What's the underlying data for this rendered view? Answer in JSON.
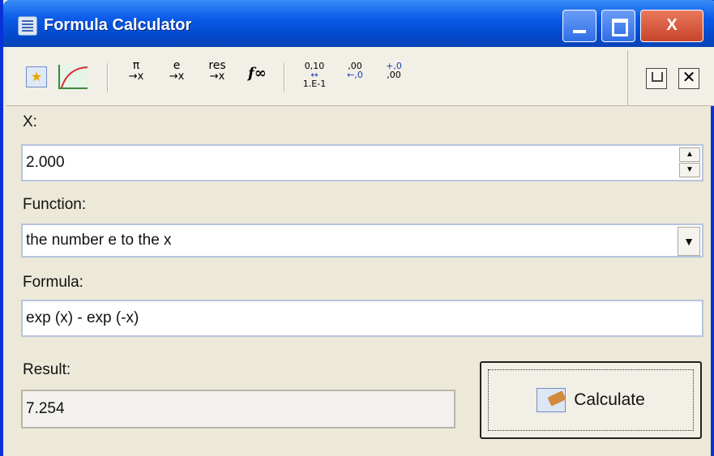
{
  "window": {
    "title": "Formula Calculator",
    "titlebar_color": "#0a5ae8"
  },
  "titlebar_buttons": {
    "minimize_icon": "minimize-icon",
    "maximize_icon": "maximize-icon",
    "close_label": "X"
  },
  "toolbar": {
    "items": [
      {
        "name": "favorites-icon"
      },
      {
        "name": "graph-icon"
      },
      {
        "top": "π",
        "bottom": "→x"
      },
      {
        "top": "e",
        "bottom": "→x"
      },
      {
        "top": "res",
        "bottom": "→x"
      },
      {
        "label": "f∞"
      },
      {
        "top": "0,10",
        "bottom": "1.E-1"
      },
      {
        "top": ",00",
        "bottom": "←,0"
      },
      {
        "top": "+,0",
        "bottom": ",00"
      }
    ],
    "right": {
      "pin_icon": "pin-icon",
      "close_icon": "close-icon",
      "close_label": "✕"
    }
  },
  "form": {
    "x_label": "X:",
    "x_value": "2.000",
    "function_label": "Function:",
    "function_value": "the number e to the x",
    "formula_label": "Formula:",
    "formula_value": "exp (x) - exp (-x)",
    "result_label": "Result:",
    "result_value": "7.254",
    "calculate_label": "Calculate"
  }
}
